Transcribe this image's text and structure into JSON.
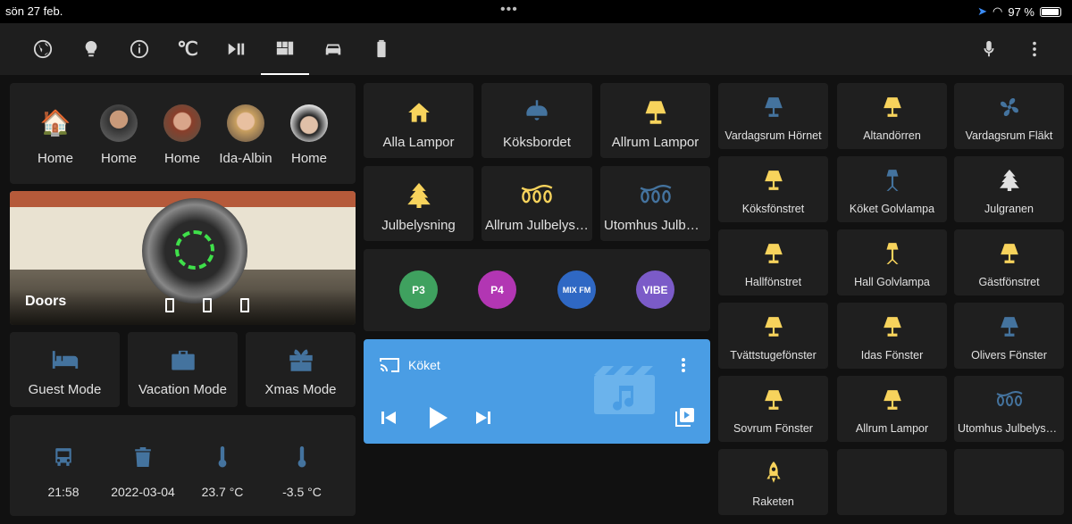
{
  "status": {
    "date": "sön 27 feb.",
    "battery": "97 %",
    "battery_level": 0.97
  },
  "tabs": [
    "globe-icon",
    "bulb-icon",
    "info-icon",
    "celsius-icon",
    "play-pause-icon",
    "dashboard-icon",
    "car-icon",
    "battery-icon"
  ],
  "tab_celsius": "℃",
  "persons": [
    {
      "name": "Home",
      "avatar": "house-icon"
    },
    {
      "name": "Home",
      "avatar": "person-photo"
    },
    {
      "name": "Home",
      "avatar": "person-photo"
    },
    {
      "name": "Ida-Albin",
      "avatar": "person-photo"
    },
    {
      "name": "Home",
      "avatar": "person-photo"
    }
  ],
  "camera": {
    "label": "Doors"
  },
  "modes": [
    {
      "label": "Guest Mode",
      "icon": "bed-icon"
    },
    {
      "label": "Vacation Mode",
      "icon": "briefcase-icon"
    },
    {
      "label": "Xmas Mode",
      "icon": "gift-icon"
    }
  ],
  "sensors": [
    {
      "value": "21:58",
      "icon": "bus-icon"
    },
    {
      "value": "2022-03-04",
      "icon": "trash-icon"
    },
    {
      "value": "23.7 °C",
      "icon": "thermometer-icon"
    },
    {
      "value": "-3.5 °C",
      "icon": "thermometer-icon"
    }
  ],
  "lights_main": [
    {
      "label": "Alla Lampor",
      "icon": "home-icon",
      "color": "#f7d35c"
    },
    {
      "label": "Köksbordet",
      "icon": "ceiling-lamp-icon",
      "color": "#44739e"
    },
    {
      "label": "Allrum Lampor",
      "icon": "lamp-icon",
      "color": "#f7d35c"
    },
    {
      "label": "Julbelysning",
      "icon": "tree-icon",
      "color": "#f7d35c"
    },
    {
      "label": "Allrum Julbelysning",
      "icon": "string-lights-icon",
      "color": "#f7d35c"
    },
    {
      "label": "Utomhus Julbelysning",
      "icon": "string-lights-icon",
      "color": "#44739e"
    }
  ],
  "radios": [
    {
      "name": "P3",
      "color": "#3fa15f"
    },
    {
      "name": "P4",
      "color": "#b236b3"
    },
    {
      "name": "MIX FM",
      "color": "#2f68c4"
    },
    {
      "name": "VIBE",
      "color": "#7b5bc8"
    }
  ],
  "media": {
    "name": "Köket"
  },
  "lights_side": [
    {
      "label": "Vardagsrum Hörnet",
      "icon": "lamp-icon",
      "color": "#44739e"
    },
    {
      "label": "Altandörren",
      "icon": "lamp-icon",
      "color": "#f7d35c"
    },
    {
      "label": "Vardagsrum Fläkt",
      "icon": "fan-icon",
      "color": "#44739e"
    },
    {
      "label": "Köksfönstret",
      "icon": "lamp-icon",
      "color": "#f7d35c"
    },
    {
      "label": "Köket Golvlampa",
      "icon": "floor-lamp-icon",
      "color": "#44739e"
    },
    {
      "label": "Julgranen",
      "icon": "tree-icon",
      "color": "#e1e1e1"
    },
    {
      "label": "Hallfönstret",
      "icon": "lamp-icon",
      "color": "#f7d35c"
    },
    {
      "label": "Hall Golvlampa",
      "icon": "floor-lamp-icon",
      "color": "#f7d35c"
    },
    {
      "label": "Gästfönstret",
      "icon": "lamp-icon",
      "color": "#f7d35c"
    },
    {
      "label": "Tvättstugefönster",
      "icon": "lamp-icon",
      "color": "#f7d35c"
    },
    {
      "label": "Idas Fönster",
      "icon": "lamp-icon",
      "color": "#f7d35c"
    },
    {
      "label": "Olivers Fönster",
      "icon": "lamp-icon",
      "color": "#44739e"
    },
    {
      "label": "Sovrum Fönster",
      "icon": "lamp-icon",
      "color": "#f7d35c"
    },
    {
      "label": "Allrum Lampor",
      "icon": "lamp-icon",
      "color": "#f7d35c"
    },
    {
      "label": "Utomhus Julbelysning",
      "icon": "string-lights-icon",
      "color": "#44739e"
    },
    {
      "label": "Raketen",
      "icon": "rocket-icon",
      "color": "#f7d35c"
    },
    {
      "label": "",
      "icon": "",
      "color": ""
    },
    {
      "label": "",
      "icon": "",
      "color": ""
    }
  ]
}
